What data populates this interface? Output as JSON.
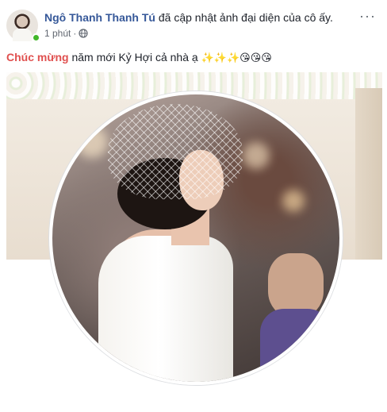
{
  "post": {
    "author": "Ngô Thanh Thanh Tú",
    "action": " đã cập nhật ảnh đại diện của cô ấy.",
    "time": "1 phút",
    "separator": "·",
    "more": "···",
    "message": {
      "highlight": "Chúc mừng",
      "text": " năm mới Kỷ Hợi cả nhà ạ ",
      "emojis": "✨✨✨😘😘😘"
    }
  },
  "colors": {
    "author": "#365899",
    "highlight": "#e0504f",
    "online": "#42b72a",
    "meta": "#616770"
  },
  "icons": {
    "more": "more-options-icon",
    "privacy": "globe-icon",
    "presence": "online-status-icon"
  }
}
